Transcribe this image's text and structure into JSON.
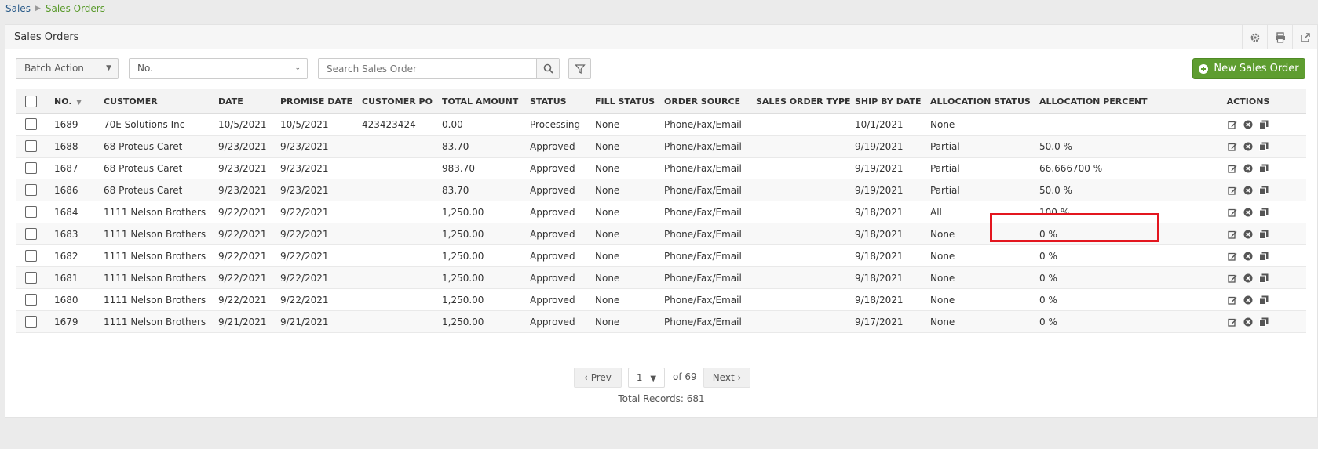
{
  "breadcrumb": {
    "root": "Sales",
    "current": "Sales Orders"
  },
  "panel": {
    "title": "Sales Orders"
  },
  "toolbar": {
    "batch_action": "Batch Action",
    "search_field": "No.",
    "search_placeholder": "Search Sales Order",
    "new_button": "New Sales Order"
  },
  "table": {
    "headers": {
      "no": "NO.",
      "customer": "CUSTOMER",
      "date": "DATE",
      "promise_date": "PROMISE DATE",
      "customer_po": "CUSTOMER PO",
      "total_amount": "TOTAL AMOUNT",
      "status": "STATUS",
      "fill_status": "FILL STATUS",
      "order_source": "ORDER SOURCE",
      "sales_order_type": "SALES ORDER TYPE",
      "ship_by_date": "SHIP BY DATE",
      "allocation_status": "ALLOCATION STATUS",
      "allocation_percent": "ALLOCATION PERCENT",
      "actions": "ACTIONS"
    },
    "rows": [
      {
        "no": "1689",
        "customer": "70E Solutions Inc",
        "date": "10/5/2021",
        "promise_date": "10/5/2021",
        "customer_po": "423423424",
        "total": "0.00",
        "status": "Processing",
        "fill": "None",
        "source": "Phone/Fax/Email",
        "type": "",
        "ship_by": "10/1/2021",
        "alloc_status": "None",
        "alloc_pct": ""
      },
      {
        "no": "1688",
        "customer": "68 Proteus Caret",
        "date": "9/23/2021",
        "promise_date": "9/23/2021",
        "customer_po": "",
        "total": "83.70",
        "status": "Approved",
        "fill": "None",
        "source": "Phone/Fax/Email",
        "type": "",
        "ship_by": "9/19/2021",
        "alloc_status": "Partial",
        "alloc_pct": "50.0 %"
      },
      {
        "no": "1687",
        "customer": "68 Proteus Caret",
        "date": "9/23/2021",
        "promise_date": "9/23/2021",
        "customer_po": "",
        "total": "983.70",
        "status": "Approved",
        "fill": "None",
        "source": "Phone/Fax/Email",
        "type": "",
        "ship_by": "9/19/2021",
        "alloc_status": "Partial",
        "alloc_pct": "66.666700 %"
      },
      {
        "no": "1686",
        "customer": "68 Proteus Caret",
        "date": "9/23/2021",
        "promise_date": "9/23/2021",
        "customer_po": "",
        "total": "83.70",
        "status": "Approved",
        "fill": "None",
        "source": "Phone/Fax/Email",
        "type": "",
        "ship_by": "9/19/2021",
        "alloc_status": "Partial",
        "alloc_pct": "50.0 %"
      },
      {
        "no": "1684",
        "customer": "1111 Nelson Brothers",
        "date": "9/22/2021",
        "promise_date": "9/22/2021",
        "customer_po": "",
        "total": "1,250.00",
        "status": "Approved",
        "fill": "None",
        "source": "Phone/Fax/Email",
        "type": "",
        "ship_by": "9/18/2021",
        "alloc_status": "All",
        "alloc_pct": "100 %"
      },
      {
        "no": "1683",
        "customer": "1111 Nelson Brothers",
        "date": "9/22/2021",
        "promise_date": "9/22/2021",
        "customer_po": "",
        "total": "1,250.00",
        "status": "Approved",
        "fill": "None",
        "source": "Phone/Fax/Email",
        "type": "",
        "ship_by": "9/18/2021",
        "alloc_status": "None",
        "alloc_pct": "0 %"
      },
      {
        "no": "1682",
        "customer": "1111 Nelson Brothers",
        "date": "9/22/2021",
        "promise_date": "9/22/2021",
        "customer_po": "",
        "total": "1,250.00",
        "status": "Approved",
        "fill": "None",
        "source": "Phone/Fax/Email",
        "type": "",
        "ship_by": "9/18/2021",
        "alloc_status": "None",
        "alloc_pct": "0 %"
      },
      {
        "no": "1681",
        "customer": "1111 Nelson Brothers",
        "date": "9/22/2021",
        "promise_date": "9/22/2021",
        "customer_po": "",
        "total": "1,250.00",
        "status": "Approved",
        "fill": "None",
        "source": "Phone/Fax/Email",
        "type": "",
        "ship_by": "9/18/2021",
        "alloc_status": "None",
        "alloc_pct": "0 %"
      },
      {
        "no": "1680",
        "customer": "1111 Nelson Brothers",
        "date": "9/22/2021",
        "promise_date": "9/22/2021",
        "customer_po": "",
        "total": "1,250.00",
        "status": "Approved",
        "fill": "None",
        "source": "Phone/Fax/Email",
        "type": "",
        "ship_by": "9/18/2021",
        "alloc_status": "None",
        "alloc_pct": "0 %"
      },
      {
        "no": "1679",
        "customer": "1111 Nelson Brothers",
        "date": "9/21/2021",
        "promise_date": "9/21/2021",
        "customer_po": "",
        "total": "1,250.00",
        "status": "Approved",
        "fill": "None",
        "source": "Phone/Fax/Email",
        "type": "",
        "ship_by": "9/17/2021",
        "alloc_status": "None",
        "alloc_pct": "0 %"
      }
    ]
  },
  "pagination": {
    "prev": "Prev",
    "page": "1",
    "of_pages": "of 69",
    "next": "Next",
    "total_records": "Total Records: 681"
  },
  "colors": {
    "accent": "#5e9d30",
    "link": "#2b5c8a",
    "highlight": "#e3161f"
  }
}
